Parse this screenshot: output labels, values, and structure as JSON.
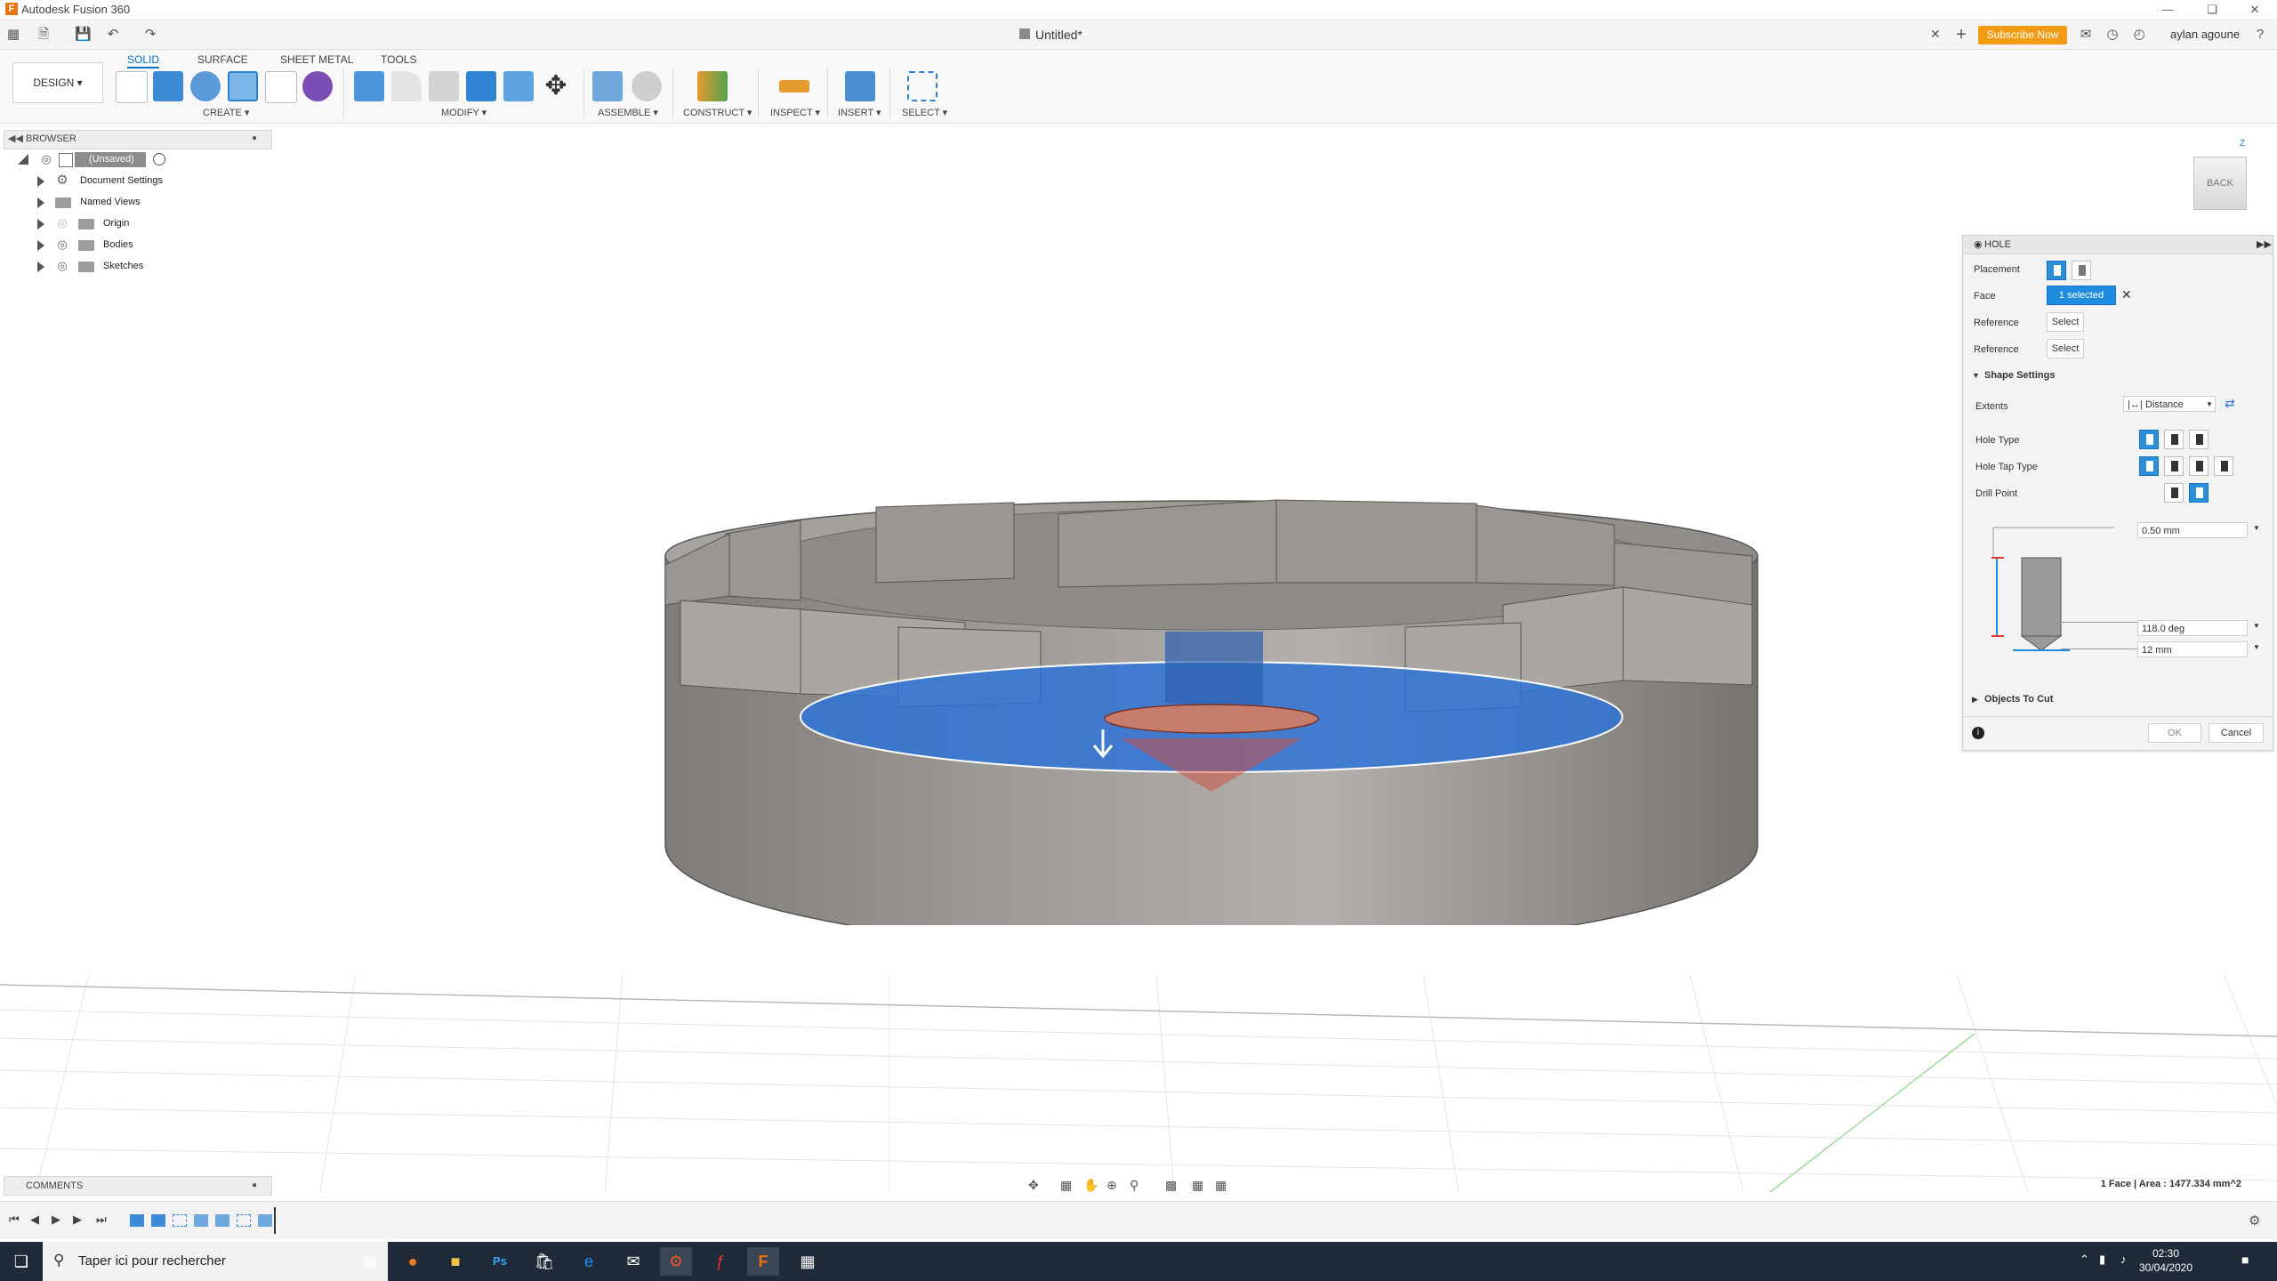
{
  "window": {
    "app_title": "Autodesk Fusion 360",
    "logo_letter": "F",
    "doc_title": "Untitled*",
    "subscribe_label": "Subscribe Now",
    "user_name": "aylan agoune"
  },
  "ribbon": {
    "workspace": "DESIGN ▾",
    "tabs": [
      "SOLID",
      "SURFACE",
      "SHEET METAL",
      "TOOLS"
    ],
    "groups": [
      "CREATE ▾",
      "MODIFY ▾",
      "ASSEMBLE ▾",
      "CONSTRUCT ▾",
      "INSPECT ▾",
      "INSERT ▾",
      "SELECT ▾"
    ]
  },
  "browser": {
    "title": "BROWSER",
    "items": [
      {
        "label": "(Unsaved)"
      },
      {
        "label": "Document Settings"
      },
      {
        "label": "Named Views"
      },
      {
        "label": "Origin"
      },
      {
        "label": "Bodies"
      },
      {
        "label": "Sketches"
      }
    ]
  },
  "viewcube": {
    "face": "BACK",
    "axis": "Z"
  },
  "hole": {
    "title": "HOLE",
    "placement_label": "Placement",
    "face_label": "Face",
    "face_value": "1 selected",
    "reference1_label": "Reference",
    "reference1_value": "Select",
    "reference2_label": "Reference",
    "reference2_value": "Select",
    "shape_settings_label": "Shape Settings",
    "extents_label": "Extents",
    "extents_value": "Distance",
    "hole_type_label": "Hole Type",
    "hole_tap_type_label": "Hole Tap Type",
    "drill_point_label": "Drill Point",
    "depth_value": "0.50 mm",
    "angle_value": "118.0 deg",
    "diameter_value": "12 mm",
    "objects_to_cut_label": "Objects To Cut",
    "ok_label": "OK",
    "cancel_label": "Cancel"
  },
  "comments": {
    "title": "COMMENTS"
  },
  "status": {
    "message": "1 Face | Area : 1477.334 mm^2"
  },
  "taskbar": {
    "search_placeholder": "Taper ici pour rechercher",
    "time": "02:30",
    "date": "30/04/2020"
  },
  "colors": {
    "accent": "#0b72c5",
    "subscribe": "#f39b13",
    "selected_face": "#2f73d6",
    "body": "#8d8a85"
  }
}
